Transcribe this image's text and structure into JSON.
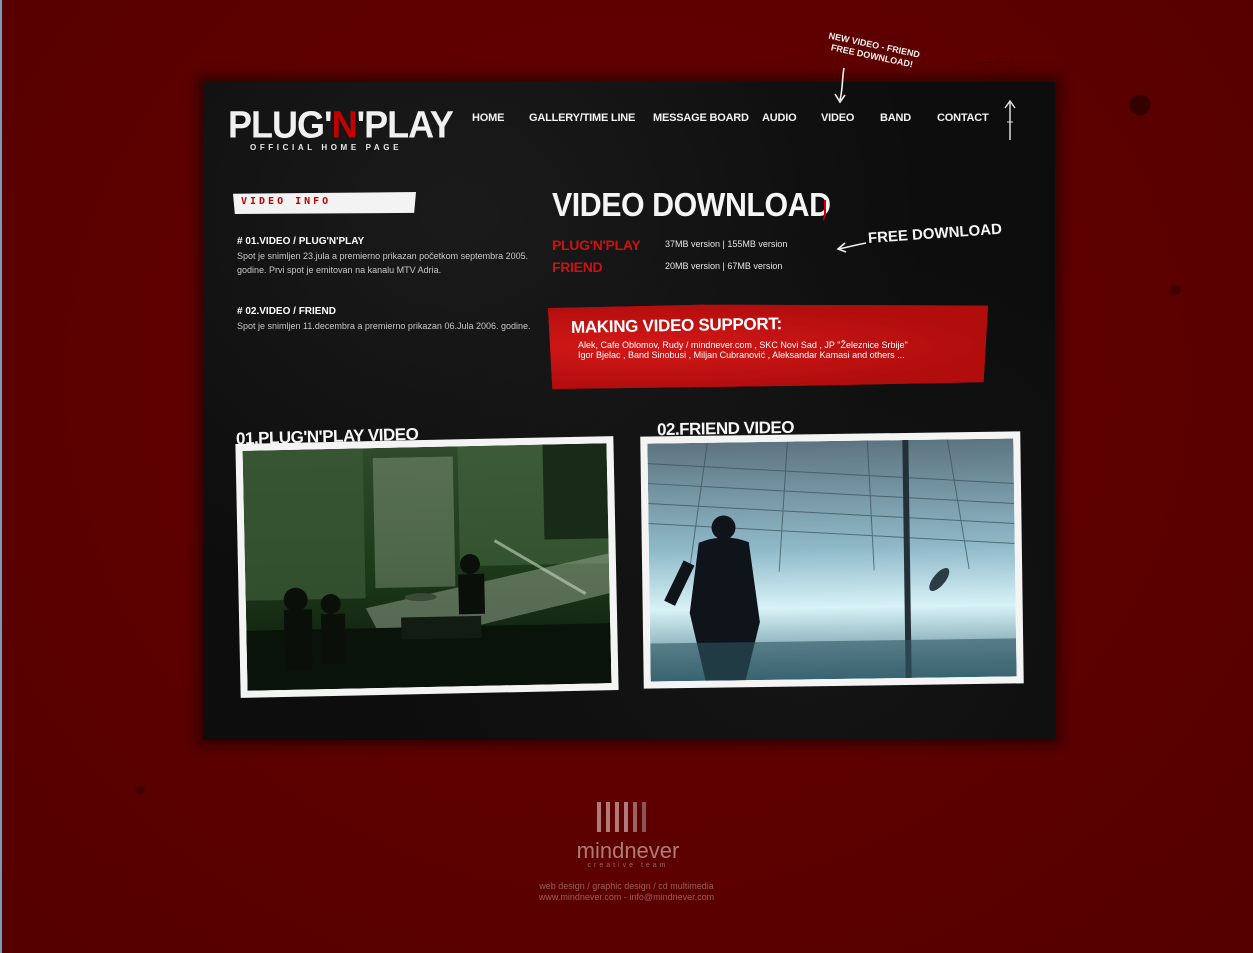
{
  "logo": {
    "main_pre": "PLUG'",
    "main_n": "N",
    "main_post": "'PLAY",
    "subtitle": "OFFICIAL HOME PAGE"
  },
  "nav": [
    {
      "label": "HOME"
    },
    {
      "label": "GALLERY/TIME LINE"
    },
    {
      "label": "MESSAGE BOARD"
    },
    {
      "label": "AUDIO"
    },
    {
      "label": "VIDEO"
    },
    {
      "label": "BAND"
    },
    {
      "label": "CONTACT"
    }
  ],
  "promo_note": {
    "line1": "NEW VIDEO - FRIEND",
    "line2": "FREE DOWNLOAD!"
  },
  "video_info": {
    "label": "VIDEO INFO",
    "items": [
      {
        "title": "# 01.VIDEO / PLUG'N'PLAY",
        "text": "Spot je snimljen 23.jula a premierno prikazan početkom septembra 2005. godine. Prvi spot je emitovan na kanalu MTV Adria."
      },
      {
        "title": "# 02.VIDEO / FRIEND",
        "text": "Spot je snimljen 11.decembra a premierno prikazan 06.Jula 2006. godine."
      }
    ]
  },
  "download": {
    "heading": "VIDEO DOWNLOAD",
    "free_label": "FREE DOWNLOAD",
    "rows": [
      {
        "name": "PLUG'N'PLAY",
        "link_a": "37MB version",
        "sep": " | ",
        "link_b": "155MB version"
      },
      {
        "name": "FRIEND",
        "link_a": "20MB version",
        "sep": " | ",
        "link_b": "67MB version"
      }
    ]
  },
  "support": {
    "title": "MAKING VIDEO SUPPORT:",
    "line1": "Alek, Cafe Oblomov, Rudy / mindnever.com , SKC Novi Sad , JP \"Železnice Srbije\"",
    "line2": "Igor Bjelac , Band Sinobusi , Miljan Cubranović , Aleksandar Kamasi and others ..."
  },
  "videos": [
    {
      "caption": "01.PLUG'N'PLAY VIDEO"
    },
    {
      "caption": "02.FRIEND VIDEO"
    }
  ],
  "footer": {
    "brand": "mindnever",
    "tagline": "creative team",
    "services": "web design / graphic design / cd multimedia",
    "site": "www.mindnever.com",
    "sep": " - ",
    "email": "info@mindnever.com"
  },
  "colors": {
    "background": "#5e0000",
    "panel": "#0d0d0d",
    "accent_red": "#cc1111",
    "banner_red": "#b50f0f"
  }
}
